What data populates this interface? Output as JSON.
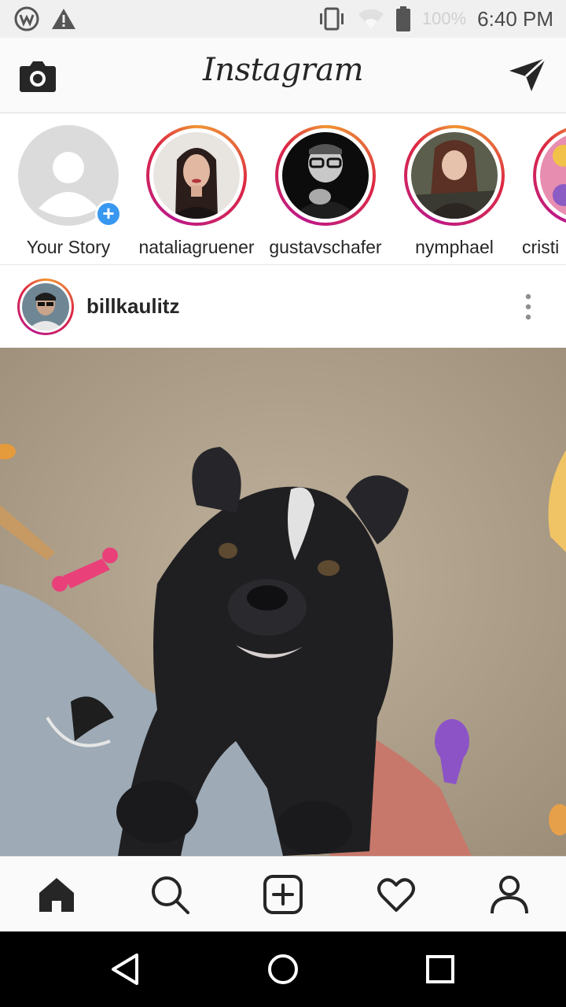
{
  "status_bar": {
    "time": "6:40 PM",
    "battery": "100%",
    "icons": [
      "app-notification-icon",
      "warning-icon",
      "vibrate-icon",
      "wifi-icon",
      "battery-icon"
    ]
  },
  "header": {
    "title": "Instagram",
    "left_icon": "camera-icon",
    "right_icon": "direct-message-icon"
  },
  "stories": [
    {
      "username": "Your Story",
      "own": true
    },
    {
      "username": "nataliagruener"
    },
    {
      "username": "gustavschafer"
    },
    {
      "username": "nymphael"
    },
    {
      "username": "cristi"
    }
  ],
  "post": {
    "username": "billkaulitz",
    "menu_icon": "more-options-icon"
  },
  "tab_bar": {
    "items": [
      "home-icon",
      "search-icon",
      "new-post-icon",
      "activity-icon",
      "profile-icon"
    ],
    "active": "home-icon"
  },
  "nav_bar": {
    "items": [
      "back-icon",
      "home-circle-icon",
      "recents-icon"
    ]
  },
  "colors": {
    "story_ring": "#dc2743",
    "add_story": "#3897f0",
    "text": "#262626"
  }
}
